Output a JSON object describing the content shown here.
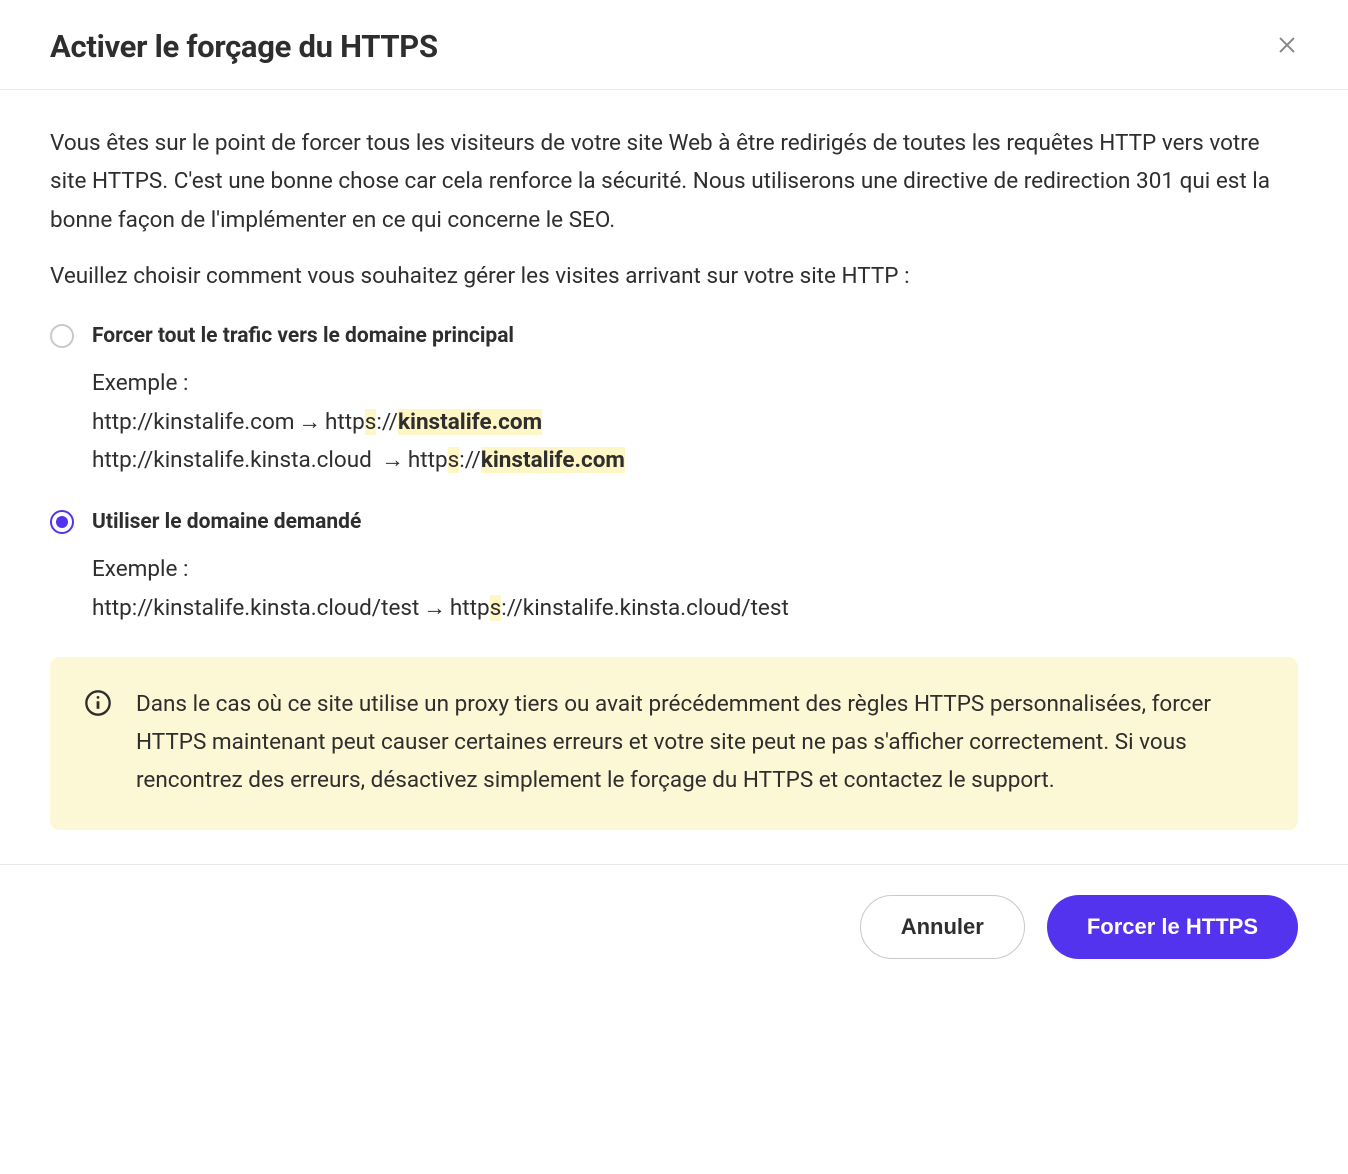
{
  "modal": {
    "title": "Activer le forçage du HTTPS",
    "intro": "Vous êtes sur le point de forcer tous les visiteurs de votre site Web à être redirigés de toutes les requêtes HTTP vers votre site HTTPS. C'est une bonne chose car cela renforce la sécurité. Nous utiliserons une directive de redirection 301 qui est la bonne façon de l'implémenter en ce qui concerne le SEO.",
    "choose": "Veuillez choisir comment vous souhaitez gérer les visites arrivant sur votre site HTTP :",
    "options": {
      "primary": {
        "label": "Forcer tout le trafic vers le domaine principal",
        "example_label": "Exemple :",
        "line1_from": "http://kinstalife.com",
        "line1_arrow": "→",
        "line1_to_prefix": "http",
        "line1_to_s": "s",
        "line1_to_mid": "://",
        "line1_to_domain": "kinstalife.com",
        "line2_from": "http://kinstalife.kinsta.cloud ",
        "line2_arrow": "→",
        "line2_to_prefix": "http",
        "line2_to_s": "s",
        "line2_to_mid": "://",
        "line2_to_domain": "kinstalife.com"
      },
      "requested": {
        "label": "Utiliser le domaine demandé",
        "selected": true,
        "example_label": "Exemple :",
        "line1_from": "http://kinstalife.kinsta.cloud/test",
        "line1_arrow": "→",
        "line1_to_prefix": "http",
        "line1_to_s": "s",
        "line1_to_rest": "://kinstalife.kinsta.cloud/test"
      }
    },
    "warning": "Dans le cas où ce site utilise un proxy tiers ou avait précédemment des règles HTTPS personnalisées, forcer HTTPS maintenant peut causer certaines erreurs et votre site peut ne pas s'afficher correctement. Si vous rencontrez des erreurs, désactivez simplement le forçage du HTTPS et contactez le support.",
    "footer": {
      "cancel": "Annuler",
      "confirm": "Forcer le HTTPS"
    }
  }
}
